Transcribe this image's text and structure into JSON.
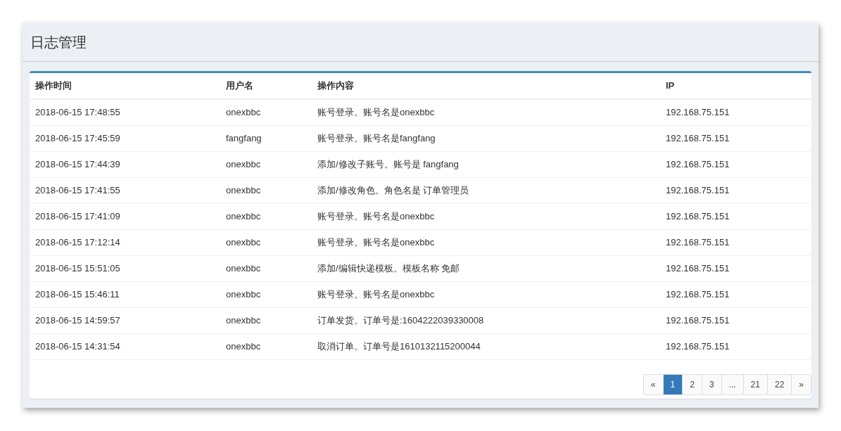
{
  "title": "日志管理",
  "table": {
    "columns": [
      "操作时间",
      "用户名",
      "操作内容",
      "IP"
    ],
    "rows": [
      [
        "2018-06-15 17:48:55",
        "onexbbc",
        "账号登录。账号名是onexbbc",
        "192.168.75.151"
      ],
      [
        "2018-06-15 17:45:59",
        "fangfang",
        "账号登录。账号名是fangfang",
        "192.168.75.151"
      ],
      [
        "2018-06-15 17:44:39",
        "onexbbc",
        "添加/修改子账号。账号是 fangfang",
        "192.168.75.151"
      ],
      [
        "2018-06-15 17:41:55",
        "onexbbc",
        "添加/修改角色。角色名是 订单管理员",
        "192.168.75.151"
      ],
      [
        "2018-06-15 17:41:09",
        "onexbbc",
        "账号登录。账号名是onexbbc",
        "192.168.75.151"
      ],
      [
        "2018-06-15 17:12:14",
        "onexbbc",
        "账号登录。账号名是onexbbc",
        "192.168.75.151"
      ],
      [
        "2018-06-15 15:51:05",
        "onexbbc",
        "添加/编辑快递模板。模板名称 免邮",
        "192.168.75.151"
      ],
      [
        "2018-06-15 15:46:11",
        "onexbbc",
        "账号登录。账号名是onexbbc",
        "192.168.75.151"
      ],
      [
        "2018-06-15 14:59:57",
        "onexbbc",
        "订单发货。订单号是:1604222039330008",
        "192.168.75.151"
      ],
      [
        "2018-06-15 14:31:54",
        "onexbbc",
        "取消订单。订单号是1610132115200044",
        "192.168.75.151"
      ]
    ]
  },
  "pagination": [
    {
      "label": "«",
      "selected": false
    },
    {
      "label": "1",
      "selected": true
    },
    {
      "label": "2",
      "selected": false
    },
    {
      "label": "3",
      "selected": false
    },
    {
      "label": "...",
      "selected": false
    },
    {
      "label": "21",
      "selected": false
    },
    {
      "label": "22",
      "selected": false
    },
    {
      "label": "»",
      "selected": false
    }
  ]
}
